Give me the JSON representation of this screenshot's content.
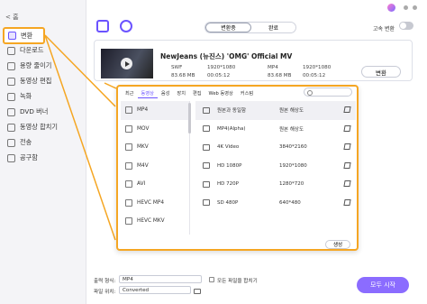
{
  "sidebar": {
    "home": "< 홈",
    "items": [
      {
        "label": "변환",
        "icon": "convert-icon",
        "active": true
      },
      {
        "label": "다운로드",
        "icon": "download-icon"
      },
      {
        "label": "용량 줄이기",
        "icon": "compress-icon"
      },
      {
        "label": "동영상 편집",
        "icon": "edit-icon"
      },
      {
        "label": "녹화",
        "icon": "record-icon"
      },
      {
        "label": "DVD 버너",
        "icon": "dvd-icon"
      },
      {
        "label": "동영상 합치기",
        "icon": "merge-icon"
      },
      {
        "label": "전송",
        "icon": "transfer-icon"
      },
      {
        "label": "공구함",
        "icon": "toolbox-icon"
      }
    ]
  },
  "header": {
    "tabs": [
      "변환중",
      "완료"
    ],
    "speed_label": "고속 변환"
  },
  "file": {
    "title": "NewJeans (뉴진스) 'OMG' Official MV",
    "source_format": "SWF",
    "source_res": "1920*1080",
    "source_size": "83.68 MB",
    "source_time": "00:05:12",
    "target_format": "MP4",
    "target_res": "1920*1080",
    "target_size": "83.68 MB",
    "target_time": "00:05:12",
    "convert_label": "변환"
  },
  "popup": {
    "tabs": [
      "최근",
      "동영상",
      "음성",
      "장치",
      "편집",
      "Web 동영상",
      "커스텀"
    ],
    "active_tab": "동영상",
    "formats": [
      "MP4",
      "MOV",
      "MKV",
      "M4V",
      "AVI",
      "HEVC MP4",
      "HEVC MKV"
    ],
    "qualities": [
      {
        "name": "원본과 동일함",
        "res": "원본 해상도"
      },
      {
        "name": "MP4(Alpha)",
        "res": "원본 해상도"
      },
      {
        "name": "4K Video",
        "res": "3840*2160"
      },
      {
        "name": "HD 1080P",
        "res": "1920*1080"
      },
      {
        "name": "HD 720P",
        "res": "1280*720"
      },
      {
        "name": "SD 480P",
        "res": "640*480"
      },
      {
        "name": "",
        "res": ""
      }
    ],
    "create_label": "생성"
  },
  "bottom": {
    "output_format_label": "출력 형식:",
    "output_format_value": "MP4",
    "merge_label": "모든 파일을 합치기",
    "file_location_label": "파일 위치:",
    "file_location_value": "Converted",
    "start_all_label": "모두 시작"
  }
}
